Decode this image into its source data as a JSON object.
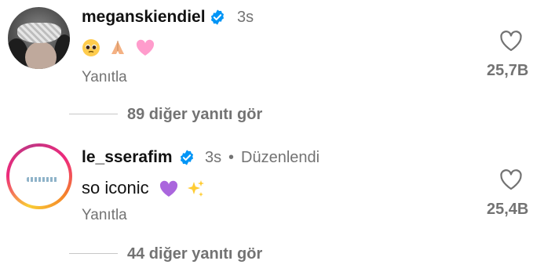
{
  "comments": [
    {
      "username": "meganskiendiel",
      "verified": true,
      "time": "3s",
      "edited_label": "",
      "text": "",
      "emojis": [
        "pleading-face",
        "folded-hands",
        "pink-heart"
      ],
      "reply_label": "Yanıtla",
      "likes": "25,7B",
      "more_replies": "89 diğer yanıtı gör"
    },
    {
      "username": "le_sserafim",
      "verified": true,
      "time": "3s",
      "separator": "•",
      "edited_label": "Düzenlendi",
      "text": "so iconic",
      "emojis": [
        "purple-heart",
        "sparkles"
      ],
      "reply_label": "Yanıtla",
      "likes": "25,4B",
      "more_replies": "44 diğer yanıtı gör"
    }
  ],
  "colors": {
    "verified_badge": "#0095f6",
    "secondary_text": "#737373",
    "primary_text": "#111111"
  }
}
